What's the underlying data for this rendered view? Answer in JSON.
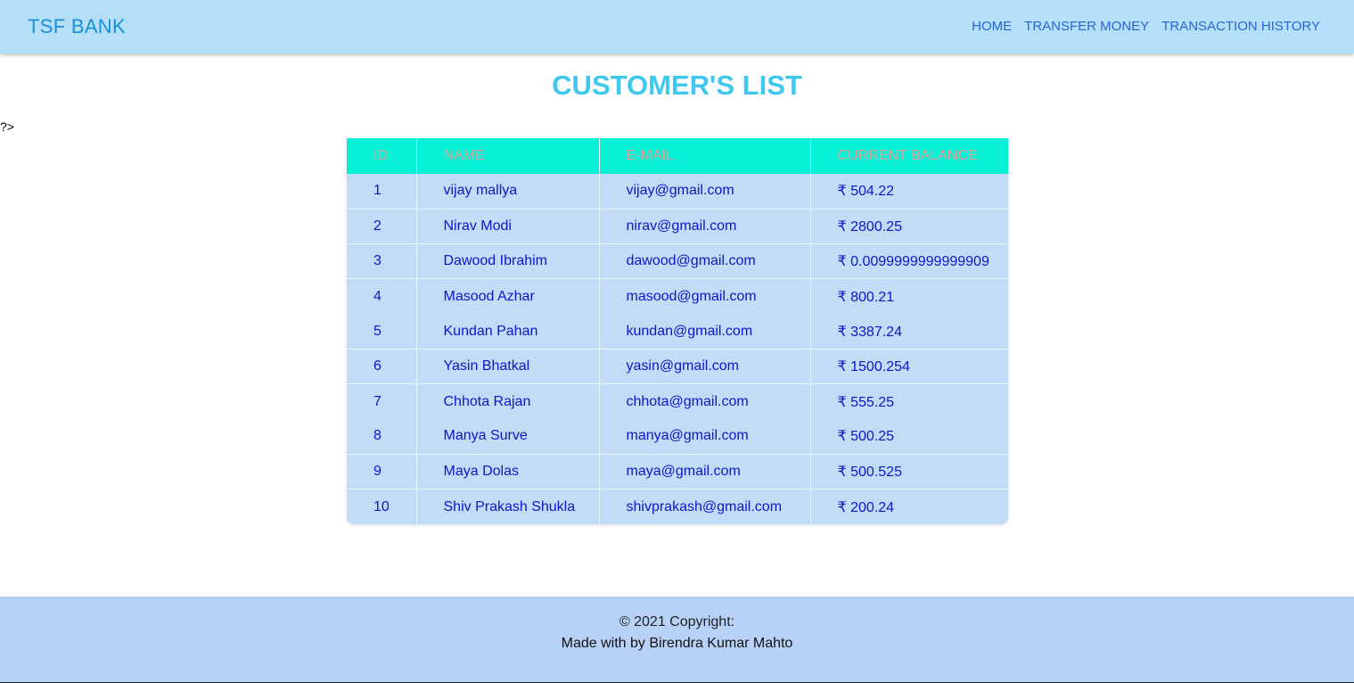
{
  "nav": {
    "brand": "TSF BANK",
    "links": [
      "HOME",
      "TRANSFER MONEY",
      "TRANSACTION HISTORY"
    ]
  },
  "page": {
    "title": "CUSTOMER'S LIST",
    "stray_text": "?>"
  },
  "table": {
    "headers": [
      "ID",
      "NAME",
      "E-MAIL",
      "CURRENT BALANCE"
    ],
    "rows": [
      {
        "id": "1",
        "name": "vijay mallya",
        "email": "vijay@gmail.com",
        "balance": "₹ 504.22"
      },
      {
        "id": "2",
        "name": "Nirav Modi",
        "email": "nirav@gmail.com",
        "balance": "₹ 2800.25"
      },
      {
        "id": "3",
        "name": "Dawood Ibrahim",
        "email": "dawood@gmail.com",
        "balance": "₹ 0.0099999999999909"
      },
      {
        "id": "4",
        "name": "Masood Azhar",
        "email": "masood@gmail.com",
        "balance": "₹ 800.21"
      },
      {
        "id": "5",
        "name": "Kundan Pahan",
        "email": "kundan@gmail.com",
        "balance": "₹ 3387.24"
      },
      {
        "id": "6",
        "name": "Yasin Bhatkal",
        "email": "yasin@gmail.com",
        "balance": "₹ 1500.254"
      },
      {
        "id": "7",
        "name": "Chhota Rajan",
        "email": "chhota@gmail.com",
        "balance": "₹ 555.25"
      },
      {
        "id": "8",
        "name": "Manya Surve",
        "email": "manya@gmail.com",
        "balance": "₹ 500.25"
      },
      {
        "id": "9",
        "name": "Maya Dolas",
        "email": "maya@gmail.com",
        "balance": "₹ 500.525"
      },
      {
        "id": "10",
        "name": "Shiv Prakash Shukla",
        "email": "shivprakash@gmail.com",
        "balance": "₹ 200.24"
      }
    ]
  },
  "footer": {
    "copyright": "© 2021 Copyright:",
    "credit": "Made with by Birendra Kumar Mahto"
  },
  "colors": {
    "navbar_bg": "#b3dff8",
    "brand": "#1a8fd6",
    "title": "#3fc8ee",
    "table_header_bg": "#08f0d6",
    "table_header_text": "#e0a09a",
    "table_body_bg": "#c2dbf7",
    "table_text": "#0b18c9",
    "footer_bg": "#b8d2f7"
  }
}
